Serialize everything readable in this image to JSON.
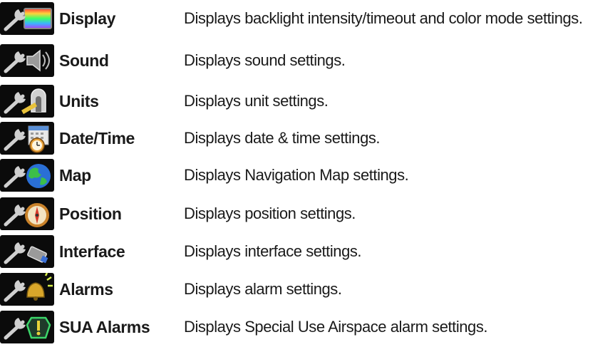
{
  "settings": [
    {
      "name": "Display",
      "description": "Displays backlight intensity/timeout and color mode settings.",
      "icon": "display-icon"
    },
    {
      "name": "Sound",
      "description": "Displays sound settings.",
      "icon": "speaker-icon"
    },
    {
      "name": "Units",
      "description": "Displays unit settings.",
      "icon": "units-icon"
    },
    {
      "name": "Date/Time",
      "description": "Displays date & time settings.",
      "icon": "calendar-clock-icon"
    },
    {
      "name": "Map",
      "description": "Displays Navigation Map settings.",
      "icon": "globe-icon"
    },
    {
      "name": "Position",
      "description": "Displays position settings.",
      "icon": "compass-icon"
    },
    {
      "name": "Interface",
      "description": "Displays interface settings.",
      "icon": "connector-icon"
    },
    {
      "name": "Alarms",
      "description": "Displays alarm settings.",
      "icon": "alarm-bell-icon"
    },
    {
      "name": "SUA Alarms",
      "description": "Displays Special Use Airspace alarm settings.",
      "icon": "airspace-alarm-icon"
    }
  ],
  "colors": {
    "icon_background": "#0b0b0b",
    "wrench": "#c8c8c8",
    "text": "#1a1a1a"
  }
}
